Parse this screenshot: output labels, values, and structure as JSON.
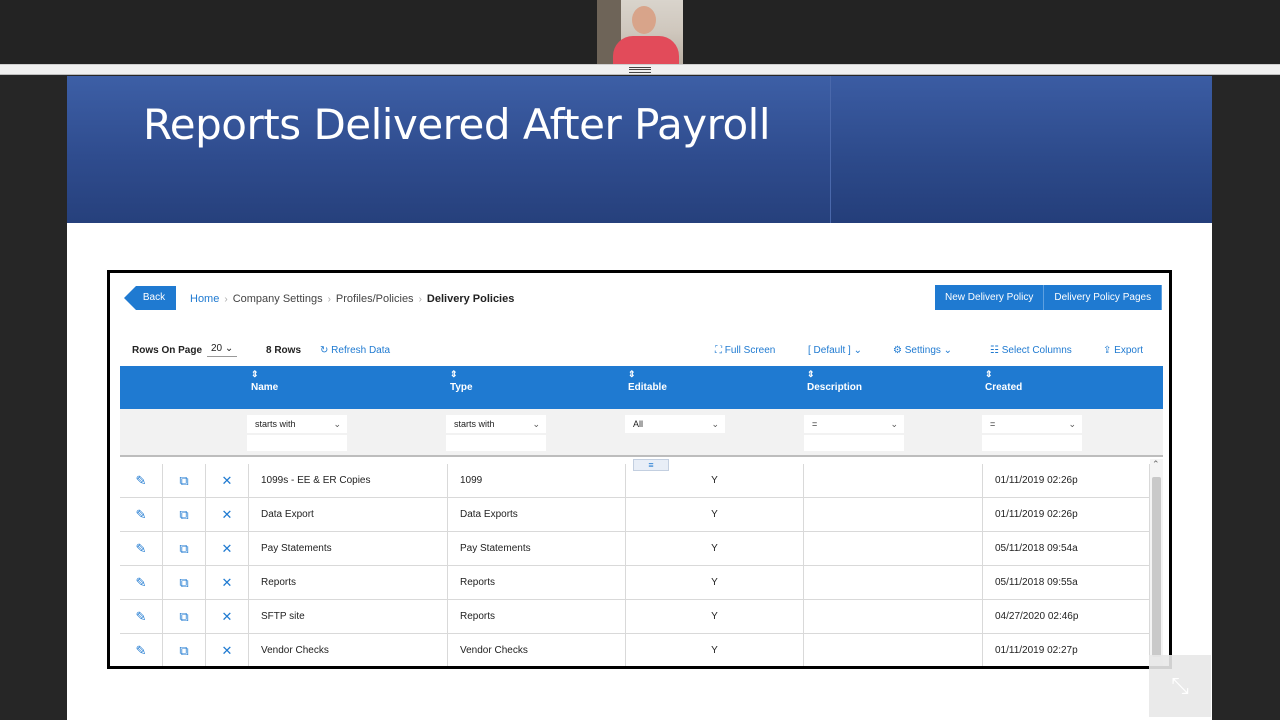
{
  "slide": {
    "title": "Reports Delivered After Payroll"
  },
  "header": {
    "back_label": "Back",
    "breadcrumbs": [
      "Home",
      "Company Settings",
      "Profiles/Policies",
      "Delivery Policies"
    ],
    "actions": [
      "New Delivery Policy",
      "Delivery Policy Pages"
    ]
  },
  "toolbar": {
    "rows_on_page_label": "Rows On Page",
    "rows_on_page_value": "20",
    "row_count": "8 Rows",
    "refresh_label": "Refresh Data",
    "full_screen_label": "Full Screen",
    "view_label": "[ Default ]",
    "settings_label": "Settings",
    "select_columns_label": "Select Columns",
    "export_label": "Export"
  },
  "grid": {
    "columns": [
      "Name",
      "Type",
      "Editable",
      "Description",
      "Created"
    ],
    "filters": [
      "starts with",
      "starts with",
      "All",
      "=",
      "="
    ],
    "rows": [
      {
        "name": "1099s - EE & ER Copies",
        "type": "1099",
        "editable": "Y",
        "description": "",
        "created": "01/11/2019 02:26p"
      },
      {
        "name": "Data Export",
        "type": "Data Exports",
        "editable": "Y",
        "description": "",
        "created": "01/11/2019 02:26p"
      },
      {
        "name": "Pay Statements",
        "type": "Pay Statements",
        "editable": "Y",
        "description": "",
        "created": "05/11/2018 09:54a"
      },
      {
        "name": "Reports",
        "type": "Reports",
        "editable": "Y",
        "description": "",
        "created": "05/11/2018 09:55a"
      },
      {
        "name": "SFTP site",
        "type": "Reports",
        "editable": "Y",
        "description": "",
        "created": "04/27/2020 02:46p"
      },
      {
        "name": "Vendor Checks",
        "type": "Vendor Checks",
        "editable": "Y",
        "description": "",
        "created": "01/11/2019 02:27p"
      }
    ]
  },
  "icons": {
    "edit": "pencil-icon",
    "copy": "copy-icon",
    "delete": "close-icon"
  },
  "colors": {
    "accent": "#1f7ad1",
    "banner": "#2f4c8e"
  }
}
